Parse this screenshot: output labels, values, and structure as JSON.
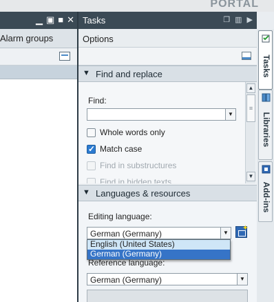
{
  "header": {
    "brand": "PORTAL"
  },
  "left_panel": {
    "window_buttons": [
      "minimize",
      "restore",
      "maximize",
      "close"
    ],
    "tab_label": "Alarm groups"
  },
  "tasks_panel": {
    "title": "Tasks",
    "options_label": "Options",
    "find_replace": {
      "title": "Find and replace",
      "find_label": "Find:",
      "find_value": "",
      "checkboxes": [
        {
          "label": "Whole words only",
          "checked": false,
          "enabled": true
        },
        {
          "label": "Match case",
          "checked": true,
          "enabled": true
        },
        {
          "label": "Find in substructures",
          "checked": false,
          "enabled": false
        },
        {
          "label": "Find in hidden texts",
          "checked": false,
          "enabled": false
        }
      ]
    },
    "languages": {
      "title": "Languages & resources",
      "editing_label": "Editing language:",
      "editing_value": "German (Germany)",
      "dropdown_options": [
        "English (United States)",
        "German (Germany)"
      ],
      "selected_option": "German (Germany)",
      "reference_label": "Reference language:",
      "reference_value": "German (Germany)"
    }
  },
  "side_tabs": [
    {
      "label": "Tasks",
      "active": true
    },
    {
      "label": "Libraries",
      "active": false
    },
    {
      "label": "Add-ins",
      "active": false
    }
  ],
  "colors": {
    "titlebar": "#3b4a55",
    "accent": "#3674c7",
    "checkbox_on": "#2c7bd1"
  }
}
